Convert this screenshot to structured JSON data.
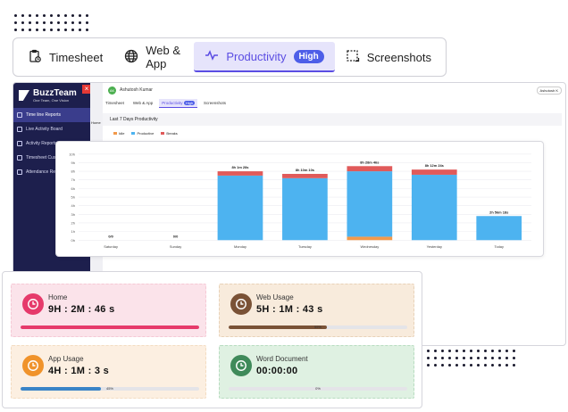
{
  "top_tabs": [
    {
      "label": "Timesheet",
      "icon": "timesheet-icon"
    },
    {
      "label": "Web & App",
      "icon": "globe-icon"
    },
    {
      "label": "Productivity",
      "icon": "pulse-icon",
      "badge": "High"
    },
    {
      "label": "Screenshots",
      "icon": "screenshot-icon"
    }
  ],
  "app": {
    "brand": "BuzzTeam",
    "brand_tagline": "One Team, One Vision",
    "sidebar": [
      "Time line Reports",
      "Live Activity Board",
      "Activity Reports",
      "Timesheet Custom",
      "Attendance Reports"
    ],
    "sub_label": "Home",
    "user_name": "Ashutosh Kumar",
    "user_initials": "AK",
    "user_chip": "Ashutosh K",
    "mini_tabs": [
      "Timesheet",
      "Web & App",
      "Productivity",
      "Screenshots"
    ],
    "mini_badge": "High",
    "period_title": "Last 7 Days Productivity",
    "legend": [
      {
        "label": "Idle",
        "color": "#f2994a"
      },
      {
        "label": "Productive",
        "color": "#4db3f0"
      },
      {
        "label": "Breaks",
        "color": "#e05a5a"
      }
    ]
  },
  "chart_data": {
    "type": "bar",
    "categories": [
      "Saturday",
      "Sunday",
      "Monday",
      "Tuesday",
      "Wednesday",
      "Yesterday",
      "Today"
    ],
    "series": [
      {
        "name": "Idle",
        "values": [
          0,
          0,
          0,
          0,
          0.4,
          0,
          0
        ]
      },
      {
        "name": "Productive",
        "values": [
          0,
          0,
          7.5,
          7.2,
          7.6,
          7.6,
          2.8
        ]
      },
      {
        "name": "Breaks",
        "values": [
          0,
          0,
          0.5,
          0.5,
          0.6,
          0.6,
          0
        ]
      }
    ],
    "data_labels": [
      "0/0",
      "0/0",
      "8h 1m 28s",
      "8h 10m 10s",
      "8h 28m 46s",
      "8h 12m 24s",
      "2h 56m 18s"
    ],
    "y_ticks": [
      "0h",
      "1h",
      "2h",
      "3h",
      "4h",
      "5h",
      "6h",
      "7h",
      "8h",
      "9h",
      "10h"
    ],
    "ylim": [
      0,
      10
    ],
    "colors": {
      "Idle": "#f2994a",
      "Productive": "#4db3f0",
      "Breaks": "#e05a5a"
    }
  },
  "stats": [
    {
      "label": "Home",
      "value": "9H : 2M : 46 s",
      "bg": "#fbe3ea",
      "border": "#f5c9d5",
      "circle": "#e63a6b",
      "bar": "#e63a6b",
      "progress": 100,
      "pct": ""
    },
    {
      "label": "Web Usage",
      "value": "5H : 1M : 43 s",
      "bg": "#f8ebdc",
      "border": "#e8d2b8",
      "circle": "#7a5236",
      "bar": "#7a5236",
      "progress": 55,
      "pct": "55%"
    },
    {
      "label": "App Usage",
      "value": "4H : 1M : 3 s",
      "bg": "#fcefe1",
      "border": "#f3dcc1",
      "circle": "#f0932b",
      "bar": "#3a84c7",
      "progress": 45,
      "pct": "45%"
    },
    {
      "label": "Word Document",
      "value": "00:00:00",
      "bg": "#dff1e2",
      "border": "#b8dcc0",
      "circle": "#3f8a5a",
      "bar": "#3f8a5a",
      "progress": 0,
      "pct": "0%"
    }
  ]
}
